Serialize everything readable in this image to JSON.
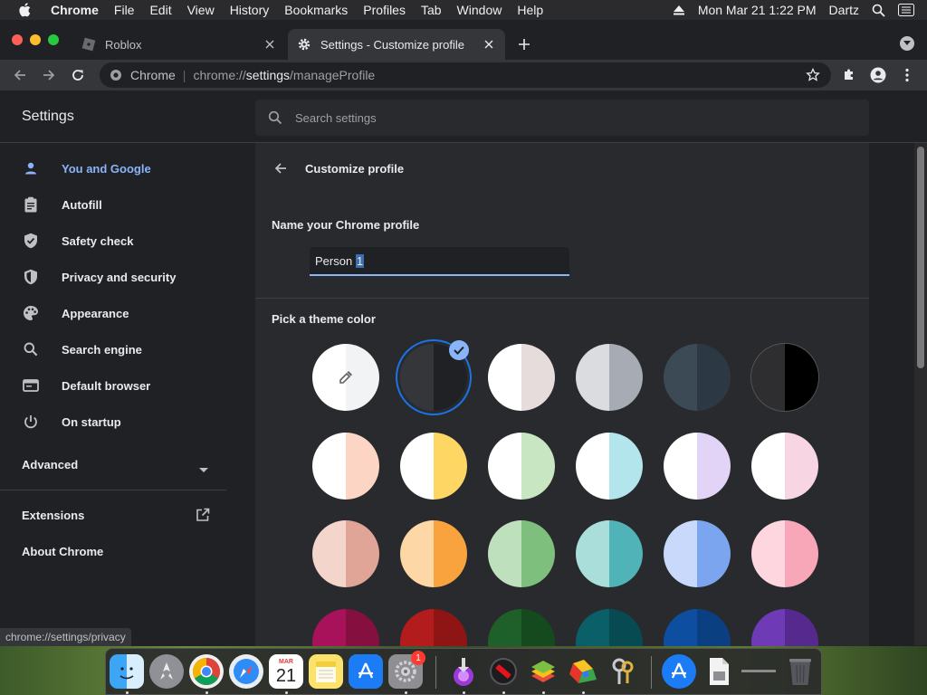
{
  "menubar": {
    "app_name": "Chrome",
    "items": [
      "File",
      "Edit",
      "View",
      "History",
      "Bookmarks",
      "Profiles",
      "Tab",
      "Window",
      "Help"
    ],
    "datetime": "Mon Mar 21  1:22 PM",
    "user": "Dartz"
  },
  "tabs": [
    {
      "title": "Roblox",
      "active": false
    },
    {
      "title": "Settings - Customize profile",
      "active": true
    }
  ],
  "omnibox": {
    "chip": "Chrome",
    "url_scheme": "chrome://",
    "url_host": "settings",
    "url_path": "/manageProfile"
  },
  "settings": {
    "title": "Settings",
    "search_placeholder": "Search settings"
  },
  "sidebar": {
    "items": [
      {
        "label": "You and Google",
        "icon": "person-icon",
        "active": true
      },
      {
        "label": "Autofill",
        "icon": "clipboard-icon",
        "active": false
      },
      {
        "label": "Safety check",
        "icon": "shield-check-icon",
        "active": false
      },
      {
        "label": "Privacy and security",
        "icon": "shield-icon",
        "active": false
      },
      {
        "label": "Appearance",
        "icon": "palette-icon",
        "active": false
      },
      {
        "label": "Search engine",
        "icon": "search-icon",
        "active": false
      },
      {
        "label": "Default browser",
        "icon": "browser-icon",
        "active": false
      },
      {
        "label": "On startup",
        "icon": "power-icon",
        "active": false
      }
    ],
    "advanced": "Advanced",
    "extensions": "Extensions",
    "about": "About Chrome"
  },
  "main": {
    "page_title": "Customize profile",
    "name_label": "Name your Chrome profile",
    "name_value_plain": "Person ",
    "name_value_selected": "1",
    "theme_label": "Pick a theme color"
  },
  "theme_colors": [
    [
      {
        "left": "#ffffff",
        "right": "#f1f3f4",
        "type": "picker"
      },
      {
        "left": "#35363a",
        "right": "#202124",
        "selected": true
      },
      {
        "left": "#ffffff",
        "right": "#e6dcdc"
      },
      {
        "left": "#dadce0",
        "right": "#a7abb3"
      },
      {
        "left": "#3c4a56",
        "right": "#2c3944"
      },
      {
        "left": "#2e2e30",
        "right": "#000000"
      }
    ],
    [
      {
        "left": "#ffffff",
        "right": "#fcd5c4"
      },
      {
        "left": "#ffffff",
        "right": "#fdd663"
      },
      {
        "left": "#ffffff",
        "right": "#c8e6c1"
      },
      {
        "left": "#ffffff",
        "right": "#b3e5ec"
      },
      {
        "left": "#ffffff",
        "right": "#e2d4f7"
      },
      {
        "left": "#ffffff",
        "right": "#f8d5e3"
      }
    ],
    [
      {
        "left": "#f3d5cc",
        "right": "#e0a596"
      },
      {
        "left": "#fdd8a6",
        "right": "#f9a33e"
      },
      {
        "left": "#bfe0bd",
        "right": "#7fbf7d"
      },
      {
        "left": "#a9dedb",
        "right": "#4fb3b7"
      },
      {
        "left": "#c8d9fb",
        "right": "#7ba5ee"
      },
      {
        "left": "#fdd6df",
        "right": "#f7a7b7"
      }
    ],
    [
      {
        "left": "#a7125a",
        "right": "#85103f"
      },
      {
        "left": "#b31c1c",
        "right": "#8f1515"
      },
      {
        "left": "#1f5f29",
        "right": "#154a1e"
      },
      {
        "left": "#0a5f68",
        "right": "#084a52"
      },
      {
        "left": "#0d4ea0",
        "right": "#0a3f82"
      },
      {
        "left": "#6f3ab6",
        "right": "#56298f"
      }
    ]
  ],
  "status_url": "chrome://settings/privacy",
  "dock": {
    "calendar_month": "MAR",
    "calendar_day": "21",
    "badge": "1"
  },
  "colors": {
    "accent": "#8ab4f8",
    "focus_ring": "#1a73e8",
    "background": "#202124",
    "surface": "#292a2d"
  }
}
